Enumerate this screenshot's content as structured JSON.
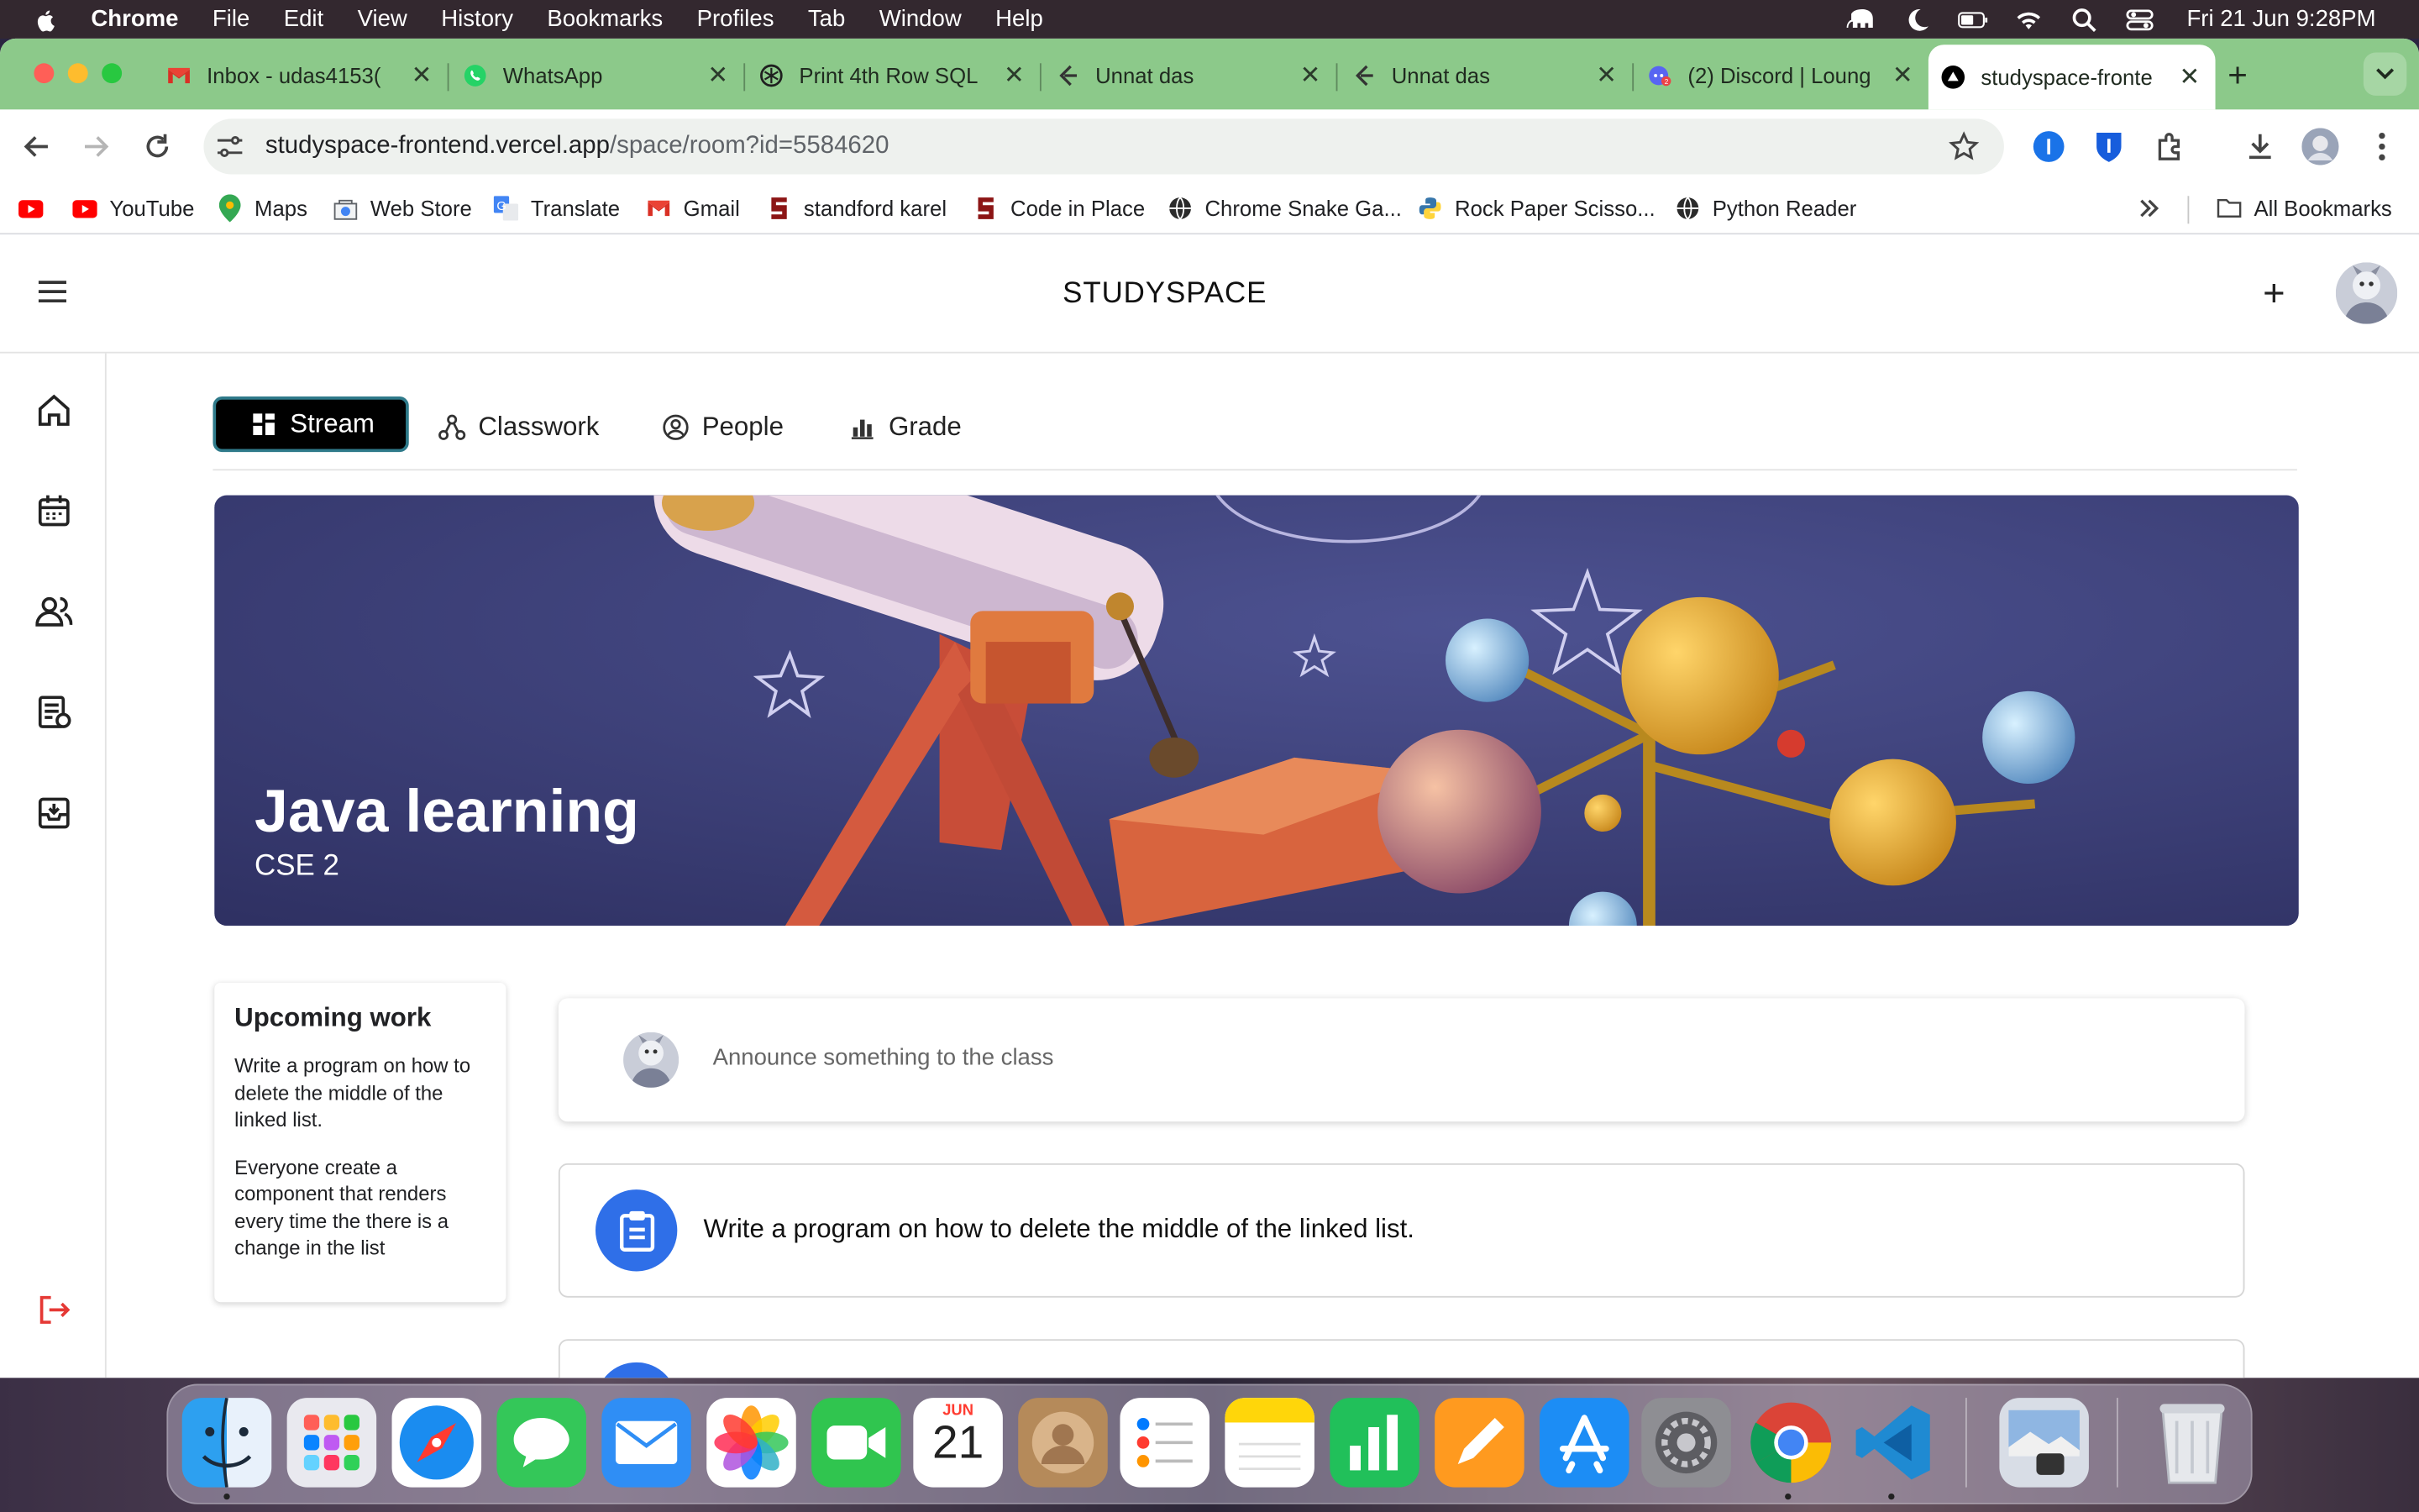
{
  "menubar": {
    "app": "Chrome",
    "items": [
      "File",
      "Edit",
      "View",
      "History",
      "Bookmarks",
      "Profiles",
      "Tab",
      "Window",
      "Help"
    ],
    "clock": "Fri 21 Jun  9:28PM"
  },
  "tabs": [
    {
      "title": "Inbox - udas4153(",
      "icon": "gmail-icon"
    },
    {
      "title": "WhatsApp",
      "icon": "whatsapp-icon"
    },
    {
      "title": "Print 4th Row SQL",
      "icon": "chatgpt-icon"
    },
    {
      "title": "Unnat das",
      "icon": "leetcode-icon"
    },
    {
      "title": "Unnat das",
      "icon": "leetcode-icon"
    },
    {
      "title": "(2) Discord | Loung",
      "icon": "discord-icon"
    },
    {
      "title": "studyspace-fronte",
      "icon": "vercel-icon"
    }
  ],
  "address": {
    "host": "studyspace-frontend.vercel.app",
    "path": "/space/room?id=5584620"
  },
  "bookmarks": {
    "items": [
      "YouTube",
      "Maps",
      "Web Store",
      "Translate",
      "Gmail",
      "standford karel",
      "Code in Place",
      "Chrome Snake Ga...",
      "Rock Paper Scisso...",
      "Python Reader"
    ],
    "all": "All Bookmarks"
  },
  "app": {
    "brand": "STUDYSPACE",
    "nav_tabs": [
      "Stream",
      "Classwork",
      "People",
      "Grade"
    ],
    "active_tab": "Stream"
  },
  "hero": {
    "title": "Java learning",
    "subtitle": "CSE 2"
  },
  "upcoming": {
    "heading": "Upcoming work",
    "items": [
      "Write a program on how to delete the middle of the linked list.",
      "Everyone create a component that renders every time the there is a change in the list"
    ]
  },
  "announce": {
    "placeholder": "Announce something to the class"
  },
  "posts": [
    {
      "text": "Write a program on how to delete the middle of the linked list."
    }
  ],
  "dock": {
    "apps": [
      "finder-icon",
      "launchpad-icon",
      "safari-icon",
      "messages-icon",
      "mail-icon",
      "photos-icon",
      "facetime-icon",
      "calendar-icon",
      "contacts-icon",
      "reminders-icon",
      "notes-icon",
      "numbers-icon",
      "pages-icon",
      "app-store-icon",
      "system-settings-icon",
      "chrome-icon",
      "vscode-icon",
      "preview-icon",
      "trash-icon"
    ],
    "calendar_month": "JUN",
    "calendar_day": "21"
  },
  "colors": {
    "tabstrip": "#8cc98a",
    "accent": "#2f6fe8",
    "hero_bg": "#3c3f74",
    "active_tab_bg": "#000000"
  }
}
